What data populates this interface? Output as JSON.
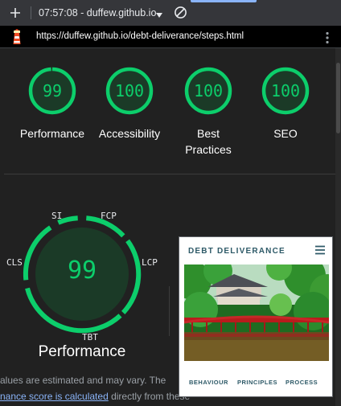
{
  "browser": {
    "tab_title": "07:57:08 - duffew.github.io",
    "url": "https://duffew.github.io/debt-deliverance/steps.html",
    "icons": {
      "new_tab": "plus-icon",
      "dropdown": "caret-down-icon",
      "blocked": "blocked-icon",
      "site": "lighthouse-icon",
      "menu": "kebab-menu-icon"
    }
  },
  "scores": [
    {
      "label": "Performance",
      "value": "99"
    },
    {
      "label": "Accessibility",
      "value": "100"
    },
    {
      "label": "Best Practices",
      "value": "100"
    },
    {
      "label": "SEO",
      "value": "100"
    }
  ],
  "performance": {
    "score": "99",
    "title": "Performance",
    "metrics": [
      "SI",
      "FCP",
      "LCP",
      "TBT",
      "CLS"
    ]
  },
  "disclaimer": {
    "line1": "alues are estimated and may vary. The",
    "link": "nance score is calculated",
    "line2_suffix": " directly from these"
  },
  "screenshot": {
    "site_title": "DEBT DELIVERANCE",
    "nav": [
      "BEHAVIOUR",
      "PRINCIPLES",
      "PROCESS"
    ]
  },
  "colors": {
    "pass": "#0cce6b",
    "background": "#212121",
    "link": "#8ab4f8"
  }
}
